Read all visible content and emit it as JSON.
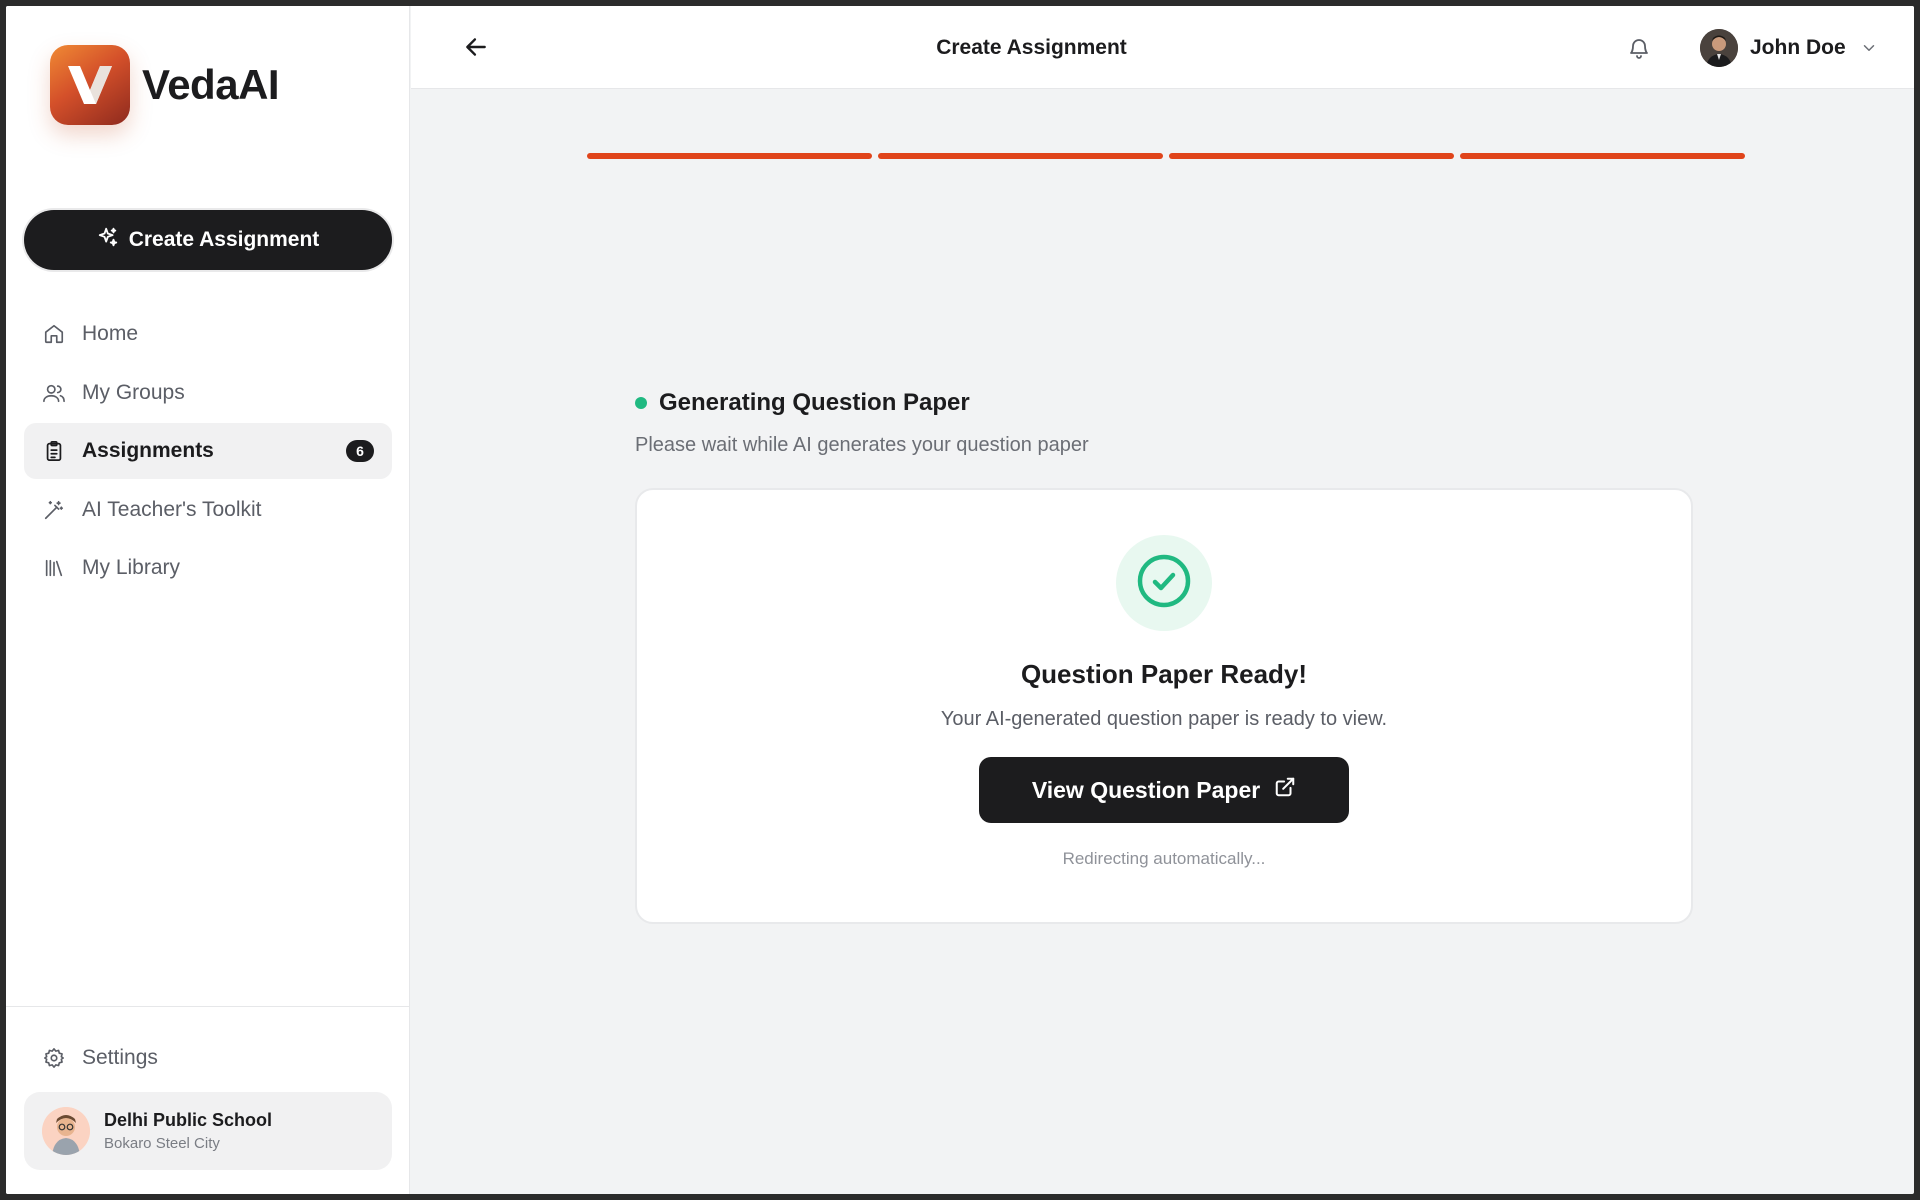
{
  "app": {
    "name": "VedaAI"
  },
  "sidebar": {
    "create_label": "Create Assignment",
    "items": [
      {
        "label": "Home",
        "icon": "home-icon"
      },
      {
        "label": "My Groups",
        "icon": "users-icon"
      },
      {
        "label": "Assignments",
        "icon": "clipboard-icon",
        "badge": "6",
        "active": true
      },
      {
        "label": "AI Teacher's Toolkit",
        "icon": "magic-wand-icon"
      },
      {
        "label": "My Library",
        "icon": "library-icon"
      }
    ],
    "settings_label": "Settings",
    "school": {
      "name": "Delhi Public School",
      "city": "Bokaro Steel City"
    }
  },
  "header": {
    "title": "Create Assignment",
    "user_name": "John Doe"
  },
  "progress": {
    "steps_total": 4,
    "steps_completed": 4,
    "color": "#e0441a"
  },
  "status": {
    "title": "Generating Question Paper",
    "subtitle": "Please wait while AI generates your question paper",
    "dot_color": "#20b981"
  },
  "result": {
    "title": "Question Paper Ready!",
    "subtitle": "Your AI-generated question paper is ready to view.",
    "button_label": "View Question Paper",
    "redirect_text": "Redirecting automatically..."
  },
  "colors": {
    "accent": "#e0441a",
    "success": "#20b981",
    "dark": "#1c1c1e"
  }
}
